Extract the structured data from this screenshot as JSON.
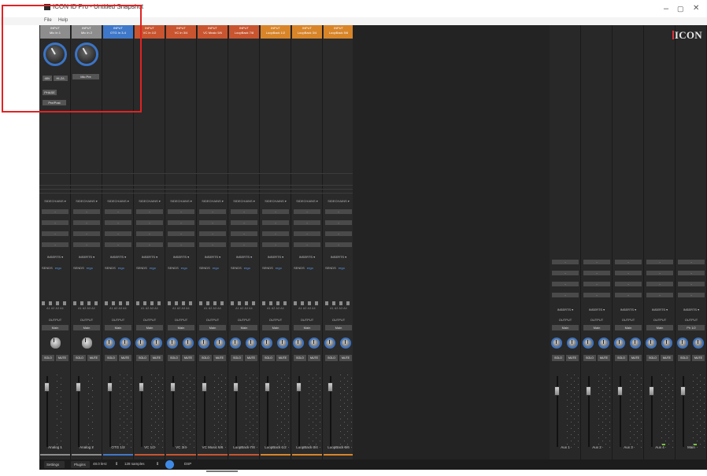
{
  "window": {
    "title": "ICON ID Pro - Untitled Snapshot",
    "minimize": "–",
    "maximize": "▢",
    "close": "✕"
  },
  "menubar": {
    "items": [
      "File",
      "Help"
    ]
  },
  "brand": {
    "logo_text": "ICON",
    "accent_color": "#d9343c"
  },
  "input_channels": [
    {
      "header": "INPUT",
      "sub": "Mic In 1",
      "name": "Analog 1",
      "color": "gray",
      "bar_color": "#8d8d8d"
    },
    {
      "header": "INPUT",
      "sub": "Mic In 2",
      "name": "Analog 2",
      "color": "gray",
      "bar_color": "#8d8d8d"
    },
    {
      "header": "INPUT",
      "sub": "OTG In 3-4",
      "name": "OTG 1/2",
      "color": "blue",
      "bar_color": "#3f78c9"
    },
    {
      "header": "INPUT",
      "sub": "VC In 1/2",
      "name": "VC 1/2",
      "color": "red",
      "bar_color": "#c8552f"
    },
    {
      "header": "INPUT",
      "sub": "VC In 3/4",
      "name": "VC 3/4",
      "color": "red",
      "bar_color": "#c8552f"
    },
    {
      "header": "INPUT",
      "sub": "VC Music 5/6",
      "name": "VC Music 5/6",
      "color": "red",
      "bar_color": "#c8552f"
    },
    {
      "header": "INPUT",
      "sub": "LoopBack 7/8",
      "name": "LoopBack 7/8",
      "color": "red",
      "bar_color": "#c8552f"
    },
    {
      "header": "INPUT",
      "sub": "LoopBack 1/2",
      "name": "LoopBack 1/2",
      "color": "orange",
      "bar_color": "#d8852a"
    },
    {
      "header": "INPUT",
      "sub": "LoopBack 3/4",
      "name": "LoopBack 3/4",
      "color": "orange",
      "bar_color": "#d8852a"
    },
    {
      "header": "INPUT",
      "sub": "LoopBack 5/6",
      "name": "LoopBack 5/6",
      "color": "orange",
      "bar_color": "#d8852a"
    }
  ],
  "aux_channels": [
    {
      "name": "Aux 1"
    },
    {
      "name": "Aux 2"
    },
    {
      "name": "Aux 3"
    },
    {
      "name": "Aux 4"
    },
    {
      "name": "Main"
    }
  ],
  "preamp": {
    "48v_label": "48V",
    "hiz_label": "HI-Z/L",
    "phase_label": "PHASE",
    "phase_value": "Pre/Post",
    "link_value": "Mic Pre"
  },
  "strip_labels": {
    "sidechain": "SIDECHAINS ▾",
    "slot_value": "-",
    "inserts": "INSERTS ▾",
    "sends": "SENDS",
    "sends_value": "ergo",
    "send_names": "A1  A2  A3  A4",
    "output": "OUTPUT",
    "output_value": "Main",
    "main_output_value": "Ph 1/2",
    "solo": "SOLO",
    "mute": "MUTE"
  },
  "status_bar": {
    "settings": "Settings",
    "plugins": "Plugins",
    "sample_rate": "48.0 kHz",
    "buffer": "128 samples",
    "dsp": "DSP",
    "spin": "⇕"
  }
}
